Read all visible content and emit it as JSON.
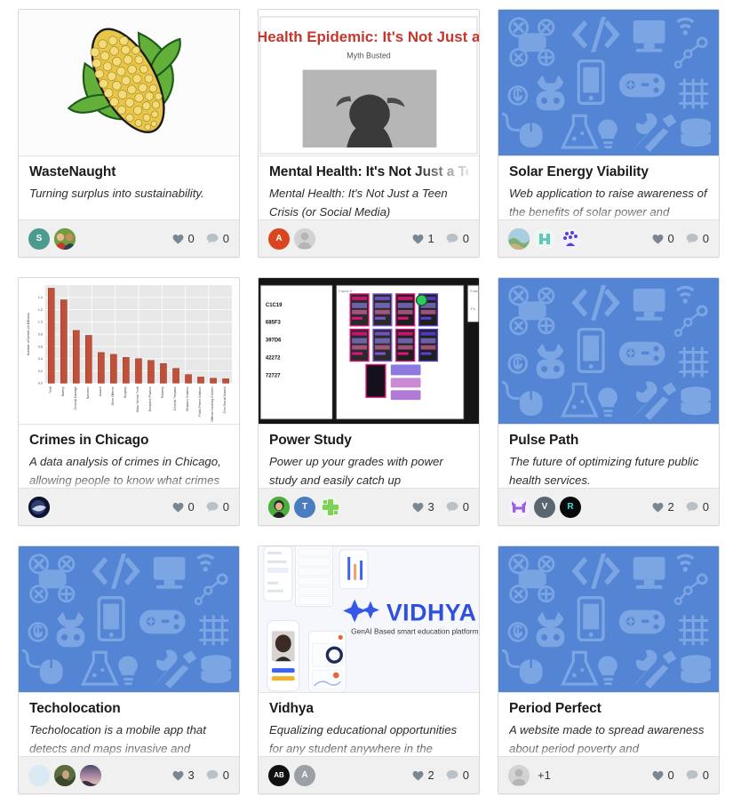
{
  "page": {
    "background": "#ffffff",
    "card_border": "#d8d8d8",
    "footer_background": "#f0f0f0",
    "placeholder_bg": "#5485d4",
    "placeholder_icon": "#7ba5e3"
  },
  "icons": {
    "heart": "heart-icon",
    "comment": "comment-icon"
  },
  "cards": [
    {
      "id": "wastenaught",
      "title": "WasteNaught",
      "title_truncated": false,
      "description": "Turning surplus into sustainability.",
      "description_truncated": false,
      "thumbnail": "corn-cob-illustration",
      "likes": "0",
      "comments": "0",
      "members": [
        {
          "name": "member-avatar-s",
          "initial": "S",
          "bg": "#4c9b8f",
          "kind": "initial"
        },
        {
          "name": "member-avatar-photo",
          "initial": "",
          "bg": "#6d4a2c",
          "kind": "photo-people"
        }
      ],
      "extra_members": ""
    },
    {
      "id": "mental-health",
      "title": "Mental Health: It's Not Just a Teen Crisis",
      "title_truncated": true,
      "description": "Mental Health: It's Not Just a Teen Crisis (or Social Media)",
      "description_truncated": false,
      "thumbnail": "presentation-slide",
      "slide_title": "Health Epidemic: It's Not Just a Tee",
      "slide_subtitle": "Myth Busted",
      "likes": "1",
      "comments": "0",
      "members": [
        {
          "name": "member-avatar-a",
          "initial": "A",
          "bg": "#d9451e",
          "kind": "initial"
        },
        {
          "name": "member-avatar-default",
          "initial": "",
          "bg": "#cfcfcf",
          "kind": "silhouette"
        }
      ],
      "extra_members": ""
    },
    {
      "id": "solar-energy-viability",
      "title": "Solar Energy Viability",
      "title_truncated": false,
      "description": "Web application to raise awareness of the benefits of solar power and",
      "description_truncated": true,
      "thumbnail": "tech-icon-placeholder",
      "likes": "0",
      "comments": "0",
      "members": [
        {
          "name": "member-avatar-landscape",
          "initial": "",
          "bg": "#8fb58a",
          "kind": "photo-landscape"
        },
        {
          "name": "member-avatar-mint",
          "initial": "",
          "bg": "#eef6f2",
          "kind": "glyph-mint"
        },
        {
          "name": "member-avatar-purple",
          "initial": "",
          "bg": "#f4f2fa",
          "kind": "glyph-purple"
        }
      ],
      "extra_members": ""
    },
    {
      "id": "crimes-in-chicago",
      "title": "Crimes in Chicago",
      "title_truncated": false,
      "description": "A data analysis of crimes in Chicago, allowing people to know what crimes",
      "description_truncated": true,
      "thumbnail": "bar-chart",
      "likes": "0",
      "comments": "0",
      "members": [
        {
          "name": "member-avatar-space",
          "initial": "",
          "bg": "#1c2340",
          "kind": "photo-space"
        }
      ],
      "extra_members": ""
    },
    {
      "id": "power-study",
      "title": "Power Study",
      "title_truncated": false,
      "description": "Power up your grades with power study and easily catch up",
      "description_truncated": false,
      "thumbnail": "design-board",
      "likes": "3",
      "comments": "0",
      "members": [
        {
          "name": "member-avatar-green-photo",
          "initial": "",
          "bg": "#4aaf3f",
          "kind": "photo-green"
        },
        {
          "name": "member-avatar-t",
          "initial": "T",
          "bg": "#4a7dc0",
          "kind": "initial"
        },
        {
          "name": "member-avatar-cross",
          "initial": "",
          "bg": "#eef7ea",
          "kind": "glyph-green"
        }
      ],
      "extra_members": ""
    },
    {
      "id": "pulse-path",
      "title": "Pulse Path",
      "title_truncated": false,
      "description": "The future of optimizing future public health services.",
      "description_truncated": false,
      "thumbnail": "tech-icon-placeholder",
      "likes": "2",
      "comments": "0",
      "members": [
        {
          "name": "member-avatar-h",
          "initial": "H",
          "bg": "#f5f1fb",
          "kind": "glyph-h"
        },
        {
          "name": "member-avatar-v",
          "initial": "V",
          "bg": "#5a6570",
          "kind": "initial"
        },
        {
          "name": "member-avatar-r",
          "initial": "R",
          "bg": "#0a0a0a",
          "kind": "initial-cyan"
        }
      ],
      "extra_members": ""
    },
    {
      "id": "techolocation",
      "title": "Techolocation",
      "title_truncated": false,
      "description": "Techolocation is a mobile app that detects and maps invasive and",
      "description_truncated": true,
      "thumbnail": "tech-icon-placeholder",
      "likes": "3",
      "comments": "0",
      "members": [
        {
          "name": "member-avatar-blank",
          "initial": "",
          "bg": "#dbeaf2",
          "kind": "plain"
        },
        {
          "name": "member-avatar-forest",
          "initial": "",
          "bg": "#4e5a3a",
          "kind": "photo-forest"
        },
        {
          "name": "member-avatar-dusk",
          "initial": "",
          "bg": "#7a6d8c",
          "kind": "photo-dusk"
        }
      ],
      "extra_members": ""
    },
    {
      "id": "vidhya",
      "title": "Vidhya",
      "title_truncated": false,
      "description": "Equalizing educational opportunities for any student anywhere in the",
      "description_truncated": true,
      "thumbnail": "vidhya-mockup",
      "brand_name": "VIDHYA",
      "brand_tagline": "GenAI Based smart education platform",
      "likes": "2",
      "comments": "0",
      "members": [
        {
          "name": "member-avatar-ab",
          "initial": "AB",
          "bg": "#111111",
          "kind": "initial"
        },
        {
          "name": "member-avatar-a2",
          "initial": "A",
          "bg": "#9aa0a6",
          "kind": "initial"
        }
      ],
      "extra_members": ""
    },
    {
      "id": "period-perfect",
      "title": "Period Perfect",
      "title_truncated": false,
      "description": "A website made to spread awareness about period poverty and",
      "description_truncated": true,
      "thumbnail": "tech-icon-placeholder",
      "likes": "0",
      "comments": "0",
      "members": [
        {
          "name": "member-avatar-default",
          "initial": "",
          "bg": "#cfcfcf",
          "kind": "silhouette"
        }
      ],
      "extra_members": "+1"
    }
  ],
  "chart_data": {
    "type": "bar",
    "title": "",
    "xlabel": "",
    "ylabel": "Number of Crimes (in Millions)",
    "categories": [
      "Theft",
      "Battery",
      "Criminal Damage",
      "Narcotics",
      "Assault",
      "Other Offense",
      "Burglary",
      "Motor Vehicle Theft",
      "Deceptive Practice",
      "Robbery",
      "Criminal Trespass",
      "Weapons Violation",
      "Public Peace Violation",
      "Offense Involving Children",
      "Crim Sexual Assault"
    ],
    "values": [
      1.55,
      1.36,
      0.86,
      0.78,
      0.5,
      0.47,
      0.42,
      0.4,
      0.37,
      0.32,
      0.24,
      0.14,
      0.1,
      0.08,
      0.07
    ],
    "ylim": [
      0,
      1.6
    ],
    "ytick_labels": [
      "0.0",
      "0.2",
      "0.4",
      "0.6",
      "0.8",
      "1.0",
      "1.2",
      "1.4"
    ],
    "grid": true,
    "legend": "none",
    "bar_color": "#c0503a",
    "plot_background": "#e8e8e8"
  }
}
